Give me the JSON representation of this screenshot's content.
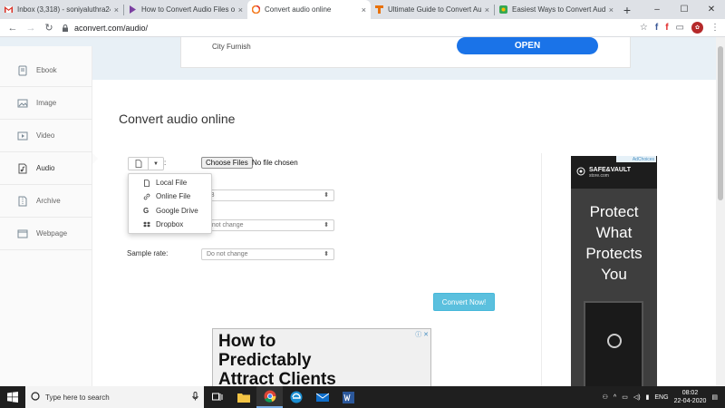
{
  "browser": {
    "tabs": [
      {
        "title": "Inbox (3,318) - soniyaluthra24@",
        "favicon_color": "#d93025",
        "active": false
      },
      {
        "title": "How to Convert Audio Files on",
        "favicon_color": "#7b3fa0",
        "active": false
      },
      {
        "title": "Convert audio online",
        "favicon_color": "#f47b20",
        "active": true
      },
      {
        "title": "Ultimate Guide to Convert Au",
        "favicon_color": "#e8710a",
        "active": false
      },
      {
        "title": "Easiest Ways to Convert Audio",
        "favicon_color": "#34a853",
        "active": false
      }
    ],
    "close_glyph": "×",
    "new_tab_glyph": "+",
    "url": "aconvert.com/audio/",
    "window_controls": [
      "–",
      "☐",
      "✕"
    ]
  },
  "ad_banner": {
    "advertiser": "City Furnish",
    "cta": "OPEN"
  },
  "sidebar": {
    "items": [
      {
        "label": "Ebook",
        "icon": "ebook-icon"
      },
      {
        "label": "Image",
        "icon": "image-icon"
      },
      {
        "label": "Video",
        "icon": "video-icon"
      },
      {
        "label": "Audio",
        "icon": "audio-icon",
        "active": true
      },
      {
        "label": "Archive",
        "icon": "archive-icon"
      },
      {
        "label": "Webpage",
        "icon": "webpage-icon"
      }
    ]
  },
  "main": {
    "title": "Convert audio online",
    "source_colon": ":",
    "choose_files": "Choose Files",
    "no_file": "No file chosen",
    "source_menu": [
      "Local File",
      "Online File",
      "Google Drive",
      "Dropbox"
    ],
    "target_format_value": "P3",
    "bitrate_value": "o not change",
    "sample_rate_label": "Sample rate:",
    "sample_rate_value": "Do not change",
    "convert_button": "Convert Now!"
  },
  "side_ad": {
    "brand": "SAFE&VAULT",
    "brand_sub": "store.com",
    "headline_lines": [
      "Protect",
      "What",
      "Protects",
      "You"
    ],
    "adchoices": "AdChoices"
  },
  "bottom_ad": {
    "lines": [
      "How to",
      "Predictably",
      "Attract Clients"
    ]
  },
  "taskbar": {
    "search_placeholder": "Type here to search",
    "tray_lang": "ENG",
    "time": "08:02",
    "date": "22-04-2020"
  }
}
